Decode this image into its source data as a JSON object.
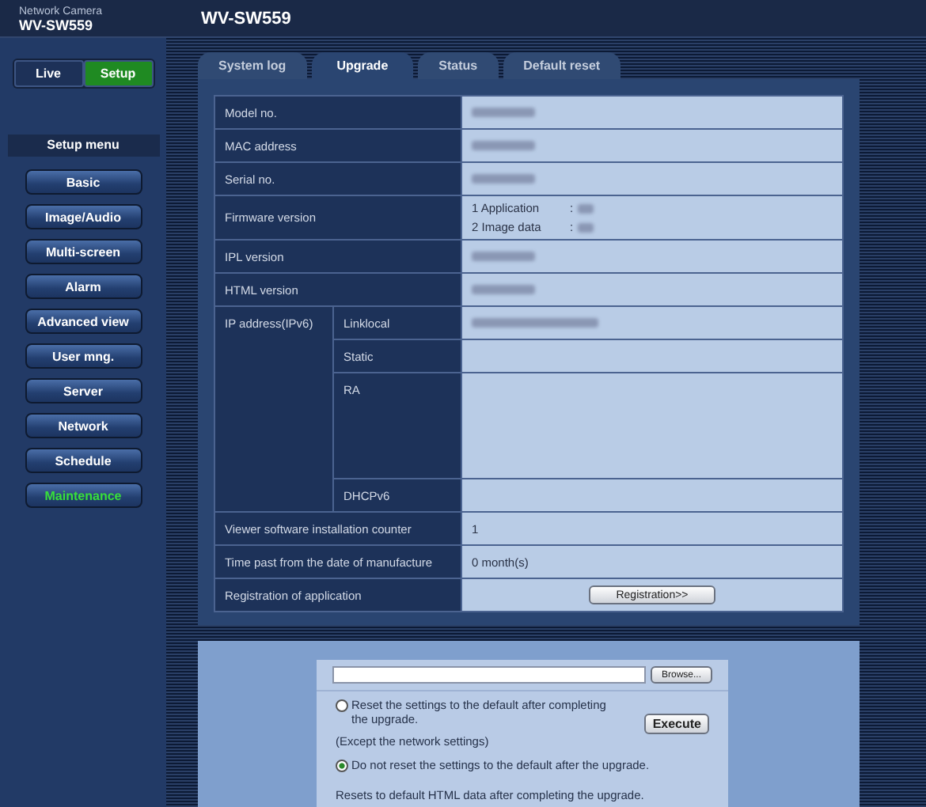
{
  "header": {
    "product": "Network Camera",
    "model": "WV-SW559",
    "title": "WV-SW559"
  },
  "mode_buttons": [
    {
      "label": "Live",
      "selected": false
    },
    {
      "label": "Setup",
      "selected": true
    }
  ],
  "sidebar": {
    "title": "Setup menu",
    "items": [
      {
        "label": "Basic",
        "selected": false
      },
      {
        "label": "Image/Audio",
        "selected": false
      },
      {
        "label": "Multi-screen",
        "selected": false
      },
      {
        "label": "Alarm",
        "selected": false
      },
      {
        "label": "Advanced view",
        "selected": false
      },
      {
        "label": "User mng.",
        "selected": false
      },
      {
        "label": "Server",
        "selected": false
      },
      {
        "label": "Network",
        "selected": false
      },
      {
        "label": "Schedule",
        "selected": false
      },
      {
        "label": "Maintenance",
        "selected": true
      }
    ]
  },
  "tabs": [
    {
      "label": "System log",
      "selected": false
    },
    {
      "label": "Upgrade",
      "selected": true
    },
    {
      "label": "Status",
      "selected": false
    },
    {
      "label": "Default reset",
      "selected": false
    }
  ],
  "info_rows": [
    {
      "label": "Model no.",
      "kind": "blurred"
    },
    {
      "label": "MAC address",
      "kind": "blurred"
    },
    {
      "label": "Serial no.",
      "kind": "blurred"
    },
    {
      "label": "Firmware version",
      "kind": "lines",
      "lines": [
        {
          "name": "1 Application",
          "sep": ":"
        },
        {
          "name": "2 Image data",
          "sep": ":"
        }
      ]
    },
    {
      "label": "IPL version",
      "kind": "blurred"
    },
    {
      "label": "HTML version",
      "kind": "blurred"
    }
  ],
  "ipv6": {
    "label": "IP address(IPv6)",
    "subs": [
      {
        "label": "Linklocal",
        "kind": "blurred"
      },
      {
        "label": "Static",
        "kind": "empty"
      },
      {
        "label": "RA",
        "kind": "tall"
      },
      {
        "label": "DHCPv6",
        "kind": "empty"
      }
    ]
  },
  "more_rows": [
    {
      "label": "Viewer software installation counter",
      "kind": "text",
      "value": "1"
    },
    {
      "label": "Time past from the date of manufacture",
      "kind": "text",
      "value": "0 month(s)"
    },
    {
      "label": "Registration of application",
      "kind": "button",
      "value": "Registration>>"
    }
  ],
  "upgrade": {
    "browse": "Browse...",
    "options": [
      {
        "label": "Reset the settings to the default after completing the upgrade.",
        "note": "(Except the network settings)",
        "selected": false
      },
      {
        "label": "Do not reset the settings to the default after the upgrade.",
        "selected": true
      }
    ],
    "execute": "Execute",
    "info": "Resets to default HTML data after completing the upgrade."
  }
}
